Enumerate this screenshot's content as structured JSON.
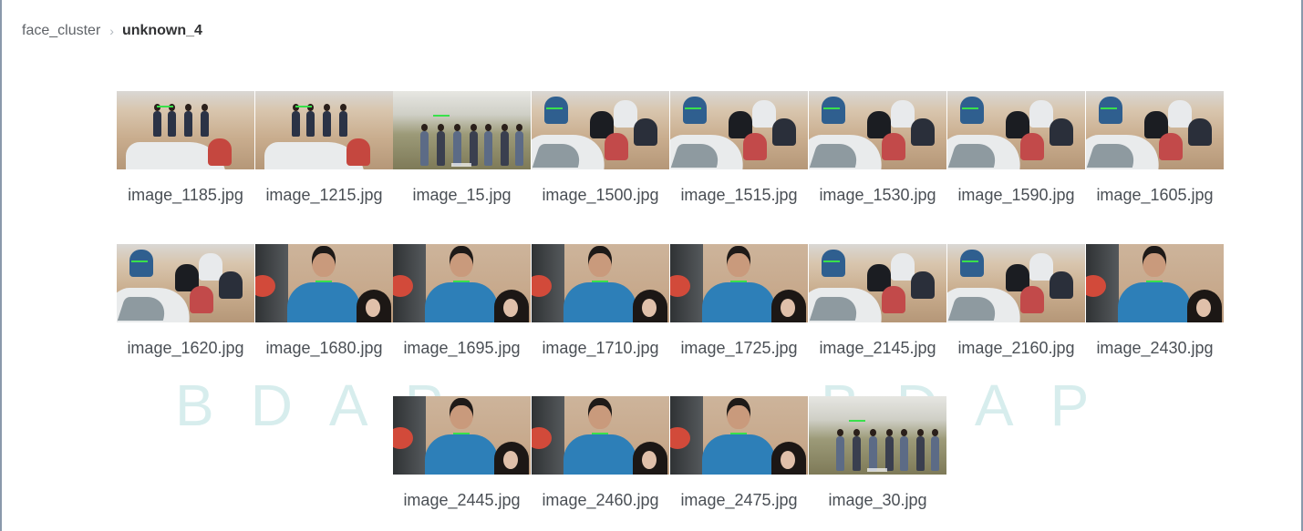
{
  "breadcrumb": {
    "parent": "face_cluster",
    "current": "unknown_4",
    "separator": "›"
  },
  "watermark": {
    "left": "BDAP",
    "right": "BDAP"
  },
  "images": [
    {
      "filename": "image_1185.jpg",
      "scene": "desert-group-car"
    },
    {
      "filename": "image_1215.jpg",
      "scene": "desert-group-car"
    },
    {
      "filename": "image_15.jpg",
      "scene": "field-group-walking"
    },
    {
      "filename": "image_1500.jpg",
      "scene": "group-at-car-top"
    },
    {
      "filename": "image_1515.jpg",
      "scene": "group-at-car-top"
    },
    {
      "filename": "image_1530.jpg",
      "scene": "group-at-car-top"
    },
    {
      "filename": "image_1590.jpg",
      "scene": "group-at-car-top"
    },
    {
      "filename": "image_1605.jpg",
      "scene": "group-at-car-top"
    },
    {
      "filename": "image_1620.jpg",
      "scene": "group-at-car-top"
    },
    {
      "filename": "image_1680.jpg",
      "scene": "man-blue-shirt"
    },
    {
      "filename": "image_1695.jpg",
      "scene": "man-blue-shirt"
    },
    {
      "filename": "image_1710.jpg",
      "scene": "man-blue-shirt"
    },
    {
      "filename": "image_1725.jpg",
      "scene": "man-blue-shirt"
    },
    {
      "filename": "image_2145.jpg",
      "scene": "group-at-car-top"
    },
    {
      "filename": "image_2160.jpg",
      "scene": "group-at-car-top"
    },
    {
      "filename": "image_2430.jpg",
      "scene": "man-blue-shirt"
    },
    {
      "filename": "image_2445.jpg",
      "scene": "man-blue-shirt"
    },
    {
      "filename": "image_2460.jpg",
      "scene": "man-blue-shirt"
    },
    {
      "filename": "image_2475.jpg",
      "scene": "man-blue-shirt"
    },
    {
      "filename": "image_30.jpg",
      "scene": "field-group-walking"
    }
  ],
  "colors": {
    "frame_border": "#8a99ab",
    "caption_text": "#4a4f55",
    "watermark": "#b8e0e0",
    "face_box": "#39e14b"
  }
}
